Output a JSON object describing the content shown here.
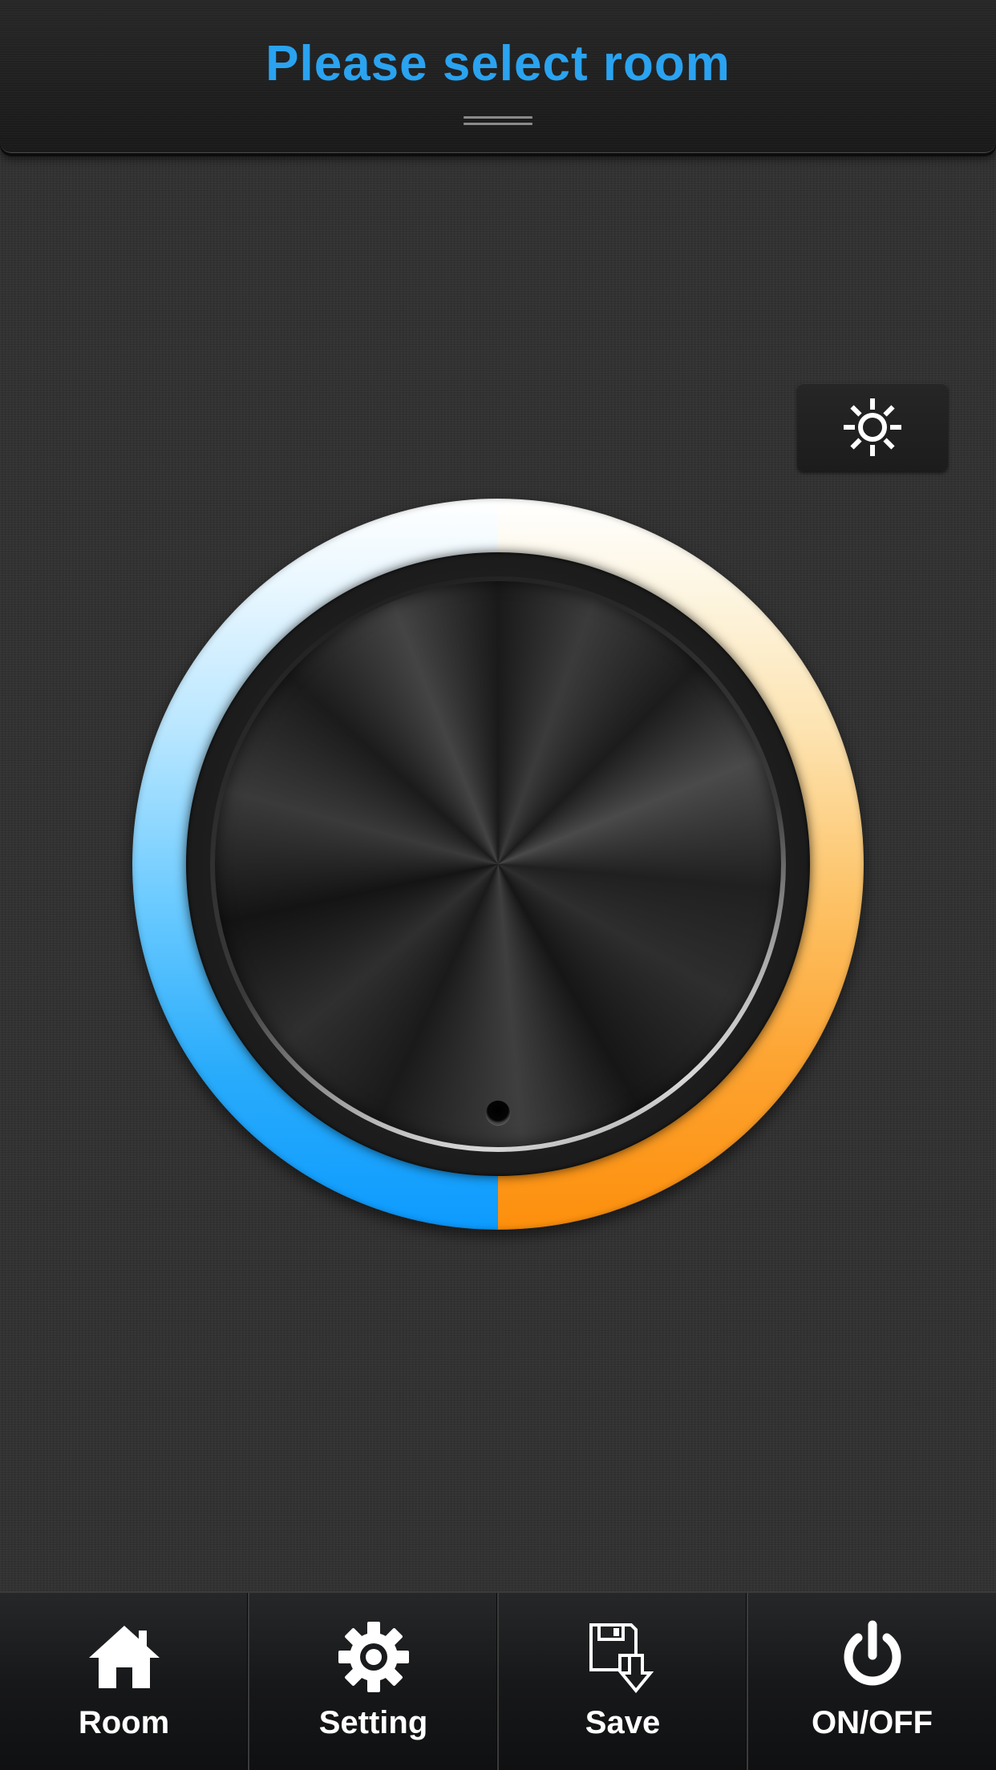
{
  "header": {
    "title": "Please select room",
    "title_color": "#2aa3f0"
  },
  "controls": {
    "brightness_button_icon": "sun-icon"
  },
  "dial": {
    "cool_color": "#0d9bff",
    "warm_color": "#fd8f0c"
  },
  "tabbar": {
    "tabs": [
      {
        "label": "Room",
        "icon": "home-icon"
      },
      {
        "label": "Setting",
        "icon": "gear-icon"
      },
      {
        "label": "Save",
        "icon": "save-icon"
      },
      {
        "label": "ON/OFF",
        "icon": "power-icon"
      }
    ]
  }
}
